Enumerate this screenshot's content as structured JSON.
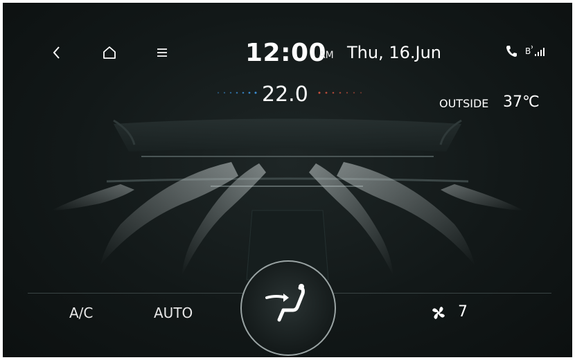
{
  "nav": {
    "back_icon": "back-chevron-icon",
    "home_icon": "home-icon",
    "menu_icon": "menu-icon"
  },
  "clock": {
    "time": "12:00",
    "ampm": "AM",
    "date": "Thu, 16.Jun"
  },
  "status": {
    "phone_icon": "phone-icon",
    "bluetooth_icon": "bluetooth-signal-icon"
  },
  "climate": {
    "set_temperature": "22.0",
    "outside_label": "OUTSIDE",
    "outside_temperature": "37℃",
    "ac_label": "A/C",
    "auto_label": "AUTO",
    "mode_icon": "airflow-seat-icon",
    "fan_icon": "fan-icon",
    "fan_level": "7"
  },
  "colors": {
    "cool_dots": "#3b8fd6",
    "warm_dots": "#c8503c",
    "text": "#ffffff",
    "background": "#131a1a"
  }
}
